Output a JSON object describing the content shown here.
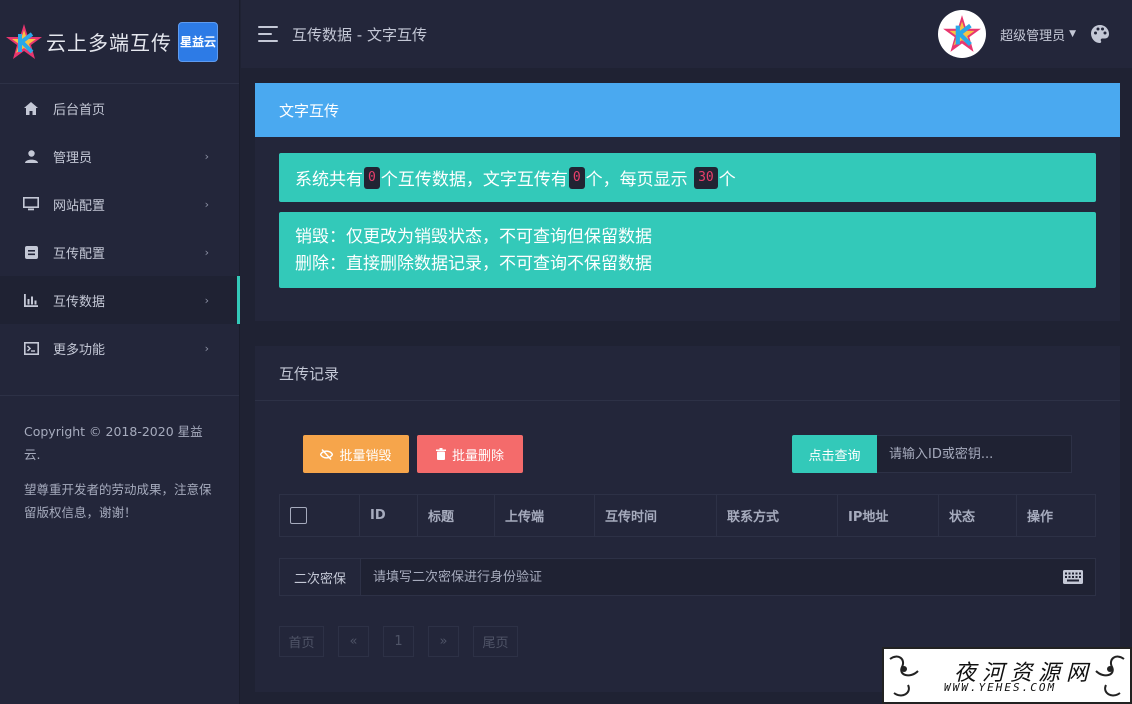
{
  "brand": {
    "name": "云上多端互传",
    "badge": "星益云"
  },
  "header": {
    "breadcrumb": "互传数据 - 文字互传",
    "username": "超级管理员"
  },
  "sidebar": {
    "items": [
      {
        "label": "后台首页",
        "icon": "home-icon",
        "has_children": false,
        "active": false
      },
      {
        "label": "管理员",
        "icon": "user-icon",
        "has_children": true,
        "active": false
      },
      {
        "label": "网站配置",
        "icon": "monitor-icon",
        "has_children": true,
        "active": false
      },
      {
        "label": "互传配置",
        "icon": "document-icon",
        "has_children": true,
        "active": false
      },
      {
        "label": "互传数据",
        "icon": "bar-chart-icon",
        "has_children": true,
        "active": true
      },
      {
        "label": "更多功能",
        "icon": "terminal-icon",
        "has_children": true,
        "active": false
      }
    ],
    "copyright": "Copyright © 2018-2020 星益云.",
    "notice": "望尊重开发者的劳动成果，注意保留版权信息，谢谢！"
  },
  "summary": {
    "title": "文字互传",
    "stats_prefix": "系统共有",
    "total_count": "0",
    "stats_mid1": "个互传数据，文字互传有",
    "text_count": "0",
    "stats_mid2": "个，每页显示",
    "per_page": "30",
    "stats_suffix": "个",
    "note_destroy": "销毁：仅更改为销毁状态，不可查询但保留数据",
    "note_delete": "删除：直接删除数据记录，不可查询不保留数据"
  },
  "records": {
    "title": "互传记录",
    "batch_destroy_label": "批量销毁",
    "batch_delete_label": "批量删除",
    "query_label": "点击查询",
    "search_placeholder": "请输入ID或密钥...",
    "columns": [
      "ID",
      "标题",
      "上传端",
      "互传时间",
      "联系方式",
      "IP地址",
      "状态",
      "操作"
    ],
    "verify_label": "二次密保",
    "verify_placeholder": "请填写二次密保进行身份验证",
    "pagination": [
      "首页",
      "«",
      "1",
      "»",
      "尾页"
    ]
  },
  "watermark": {
    "text": "夜河资源网",
    "url": "WWW.YEHES.COM"
  },
  "colors": {
    "accent": "#33c9b9",
    "header_blue": "#4aa9f0",
    "warning": "#f6a54b",
    "danger": "#f46b6b"
  }
}
